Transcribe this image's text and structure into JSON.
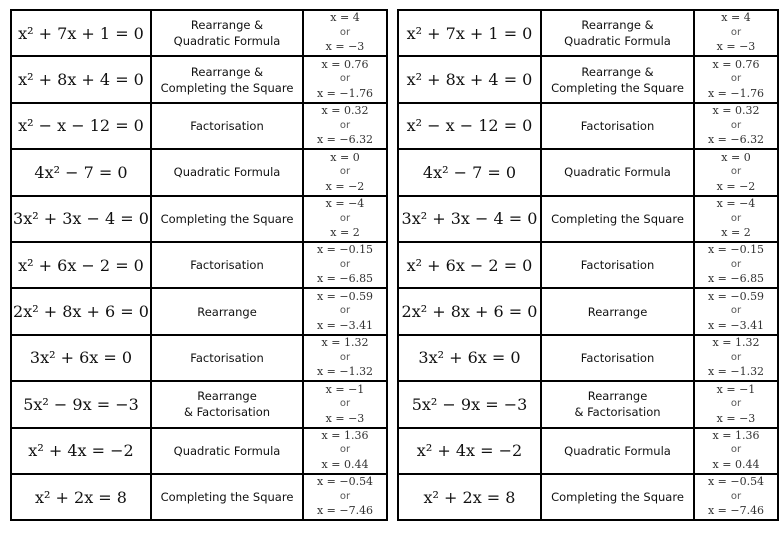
{
  "rows": [
    {
      "equation": "x² + 7x + 1 = 0",
      "method": [
        "Rearrange &",
        "Quadratic Formula"
      ],
      "answer": [
        "x = 4",
        "or",
        "x = −3"
      ]
    },
    {
      "equation": "x² + 8x + 4 = 0",
      "method": [
        "Rearrange &",
        "Completing the Square"
      ],
      "answer": [
        "x = 0.76",
        "or",
        "x = −1.76"
      ]
    },
    {
      "equation": "x² − x − 12 = 0",
      "method": [
        "Factorisation"
      ],
      "answer": [
        "x = 0.32",
        "or",
        "x = −6.32"
      ]
    },
    {
      "equation": "4x² − 7 = 0",
      "method": [
        "Quadratic Formula"
      ],
      "answer": [
        "x = 0",
        "or",
        "x = −2"
      ]
    },
    {
      "equation": "3x² + 3x − 4 = 0",
      "method": [
        "Completing the Square"
      ],
      "answer": [
        "x = −4",
        "or",
        "x = 2"
      ]
    },
    {
      "equation": "x² + 6x − 2 = 0",
      "method": [
        "Factorisation"
      ],
      "answer": [
        "x = −0.15",
        "or",
        "x = −6.85"
      ]
    },
    {
      "equation": "2x² + 8x + 6 = 0",
      "method": [
        "Rearrange"
      ],
      "answer": [
        "x = −0.59",
        "or",
        "x = −3.41"
      ]
    },
    {
      "equation": "3x² + 6x = 0",
      "method": [
        "Factorisation"
      ],
      "answer": [
        "x = 1.32",
        "or",
        "x = −1.32"
      ]
    },
    {
      "equation": "5x² − 9x = −3",
      "method": [
        "Rearrange",
        "& Factorisation"
      ],
      "answer": [
        "x = −1",
        "or",
        "x = −3"
      ]
    },
    {
      "equation": "x² + 4x = −2",
      "method": [
        "Quadratic Formula"
      ],
      "answer": [
        "x = 1.36",
        "or",
        "x = 0.44"
      ]
    },
    {
      "equation": "x² + 2x = 8",
      "method": [
        "Completing the Square"
      ],
      "answer": [
        "x = −0.54",
        "or",
        "x = −7.46"
      ]
    }
  ]
}
